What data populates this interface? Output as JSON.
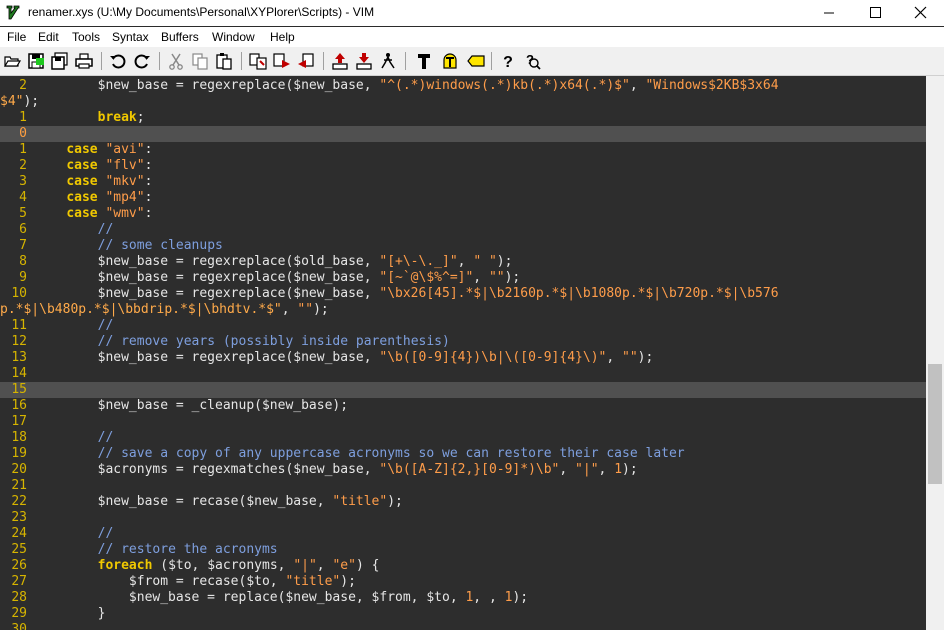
{
  "window": {
    "title": "renamer.xys (U:\\My Documents\\Personal\\XYPlorer\\Scripts) - VIM",
    "minimize_icon": "minimize-icon",
    "maximize_icon": "maximize-icon",
    "close_icon": "close-icon"
  },
  "menu": {
    "items": [
      "File",
      "Edit",
      "Tools",
      "Syntax",
      "Buffers",
      "Window",
      "Help"
    ]
  },
  "toolbar": {
    "icons": [
      "open-icon",
      "save-icon",
      "save-all-icon",
      "print-icon",
      "undo-icon",
      "redo-icon",
      "cut-icon",
      "copy-icon",
      "paste-icon",
      "find-replace-icon",
      "find-next-icon",
      "find-previous-icon",
      "load-session-icon",
      "save-session-icon",
      "run-script-icon",
      "make-icon",
      "run-ctags-icon",
      "jump-to-tag-icon",
      "help-icon",
      "find-help-icon"
    ]
  },
  "editor": {
    "lines": [
      {
        "num": "2",
        "segs": [
          [
            "code",
            "        $new_base = regexreplace($new_base, "
          ],
          [
            "str",
            "\"^(.*)windows(.*)kb(.*)x64(.*)$\""
          ],
          [
            "code",
            ", "
          ],
          [
            "str",
            "\"Windows$2KB$3x64"
          ]
        ]
      },
      {
        "num": "",
        "cont": "$4\"",
        "segs": [
          [
            "code",
            ");"
          ]
        ]
      },
      {
        "num": "1",
        "segs": [
          [
            "code",
            "        "
          ],
          [
            "kw",
            "break"
          ],
          [
            "code",
            ";"
          ]
        ]
      },
      {
        "num": "0",
        "cur": true,
        "segs": [
          [
            "code",
            ""
          ]
        ]
      },
      {
        "num": "1",
        "segs": [
          [
            "code",
            "    "
          ],
          [
            "kw",
            "case"
          ],
          [
            "code",
            " "
          ],
          [
            "str",
            "\"avi\""
          ],
          [
            "code",
            ":"
          ]
        ]
      },
      {
        "num": "2",
        "segs": [
          [
            "code",
            "    "
          ],
          [
            "kw",
            "case"
          ],
          [
            "code",
            " "
          ],
          [
            "str",
            "\"flv\""
          ],
          [
            "code",
            ":"
          ]
        ]
      },
      {
        "num": "3",
        "segs": [
          [
            "code",
            "    "
          ],
          [
            "kw",
            "case"
          ],
          [
            "code",
            " "
          ],
          [
            "str",
            "\"mkv\""
          ],
          [
            "code",
            ":"
          ]
        ]
      },
      {
        "num": "4",
        "segs": [
          [
            "code",
            "    "
          ],
          [
            "kw",
            "case"
          ],
          [
            "code",
            " "
          ],
          [
            "str",
            "\"mp4\""
          ],
          [
            "code",
            ":"
          ]
        ]
      },
      {
        "num": "5",
        "segs": [
          [
            "code",
            "    "
          ],
          [
            "kw",
            "case"
          ],
          [
            "code",
            " "
          ],
          [
            "str",
            "\"wmv\""
          ],
          [
            "code",
            ":"
          ]
        ]
      },
      {
        "num": "6",
        "segs": [
          [
            "code",
            "        "
          ],
          [
            "cmt",
            "//"
          ]
        ]
      },
      {
        "num": "7",
        "segs": [
          [
            "code",
            "        "
          ],
          [
            "cmt",
            "// some cleanups"
          ]
        ]
      },
      {
        "num": "8",
        "segs": [
          [
            "code",
            "        $new_base = regexreplace($old_base, "
          ],
          [
            "str",
            "\"[+\\-\\._]\""
          ],
          [
            "code",
            ", "
          ],
          [
            "str",
            "\" \""
          ],
          [
            "code",
            ");"
          ]
        ]
      },
      {
        "num": "9",
        "segs": [
          [
            "code",
            "        $new_base = regexreplace($new_base, "
          ],
          [
            "str",
            "\"[~`@\\$%^=]\""
          ],
          [
            "code",
            ", "
          ],
          [
            "str",
            "\"\""
          ],
          [
            "code",
            ");"
          ]
        ]
      },
      {
        "num": "10",
        "segs": [
          [
            "code",
            "        $new_base = regexreplace($new_base, "
          ],
          [
            "str",
            "\"\\bx26[45].*$|\\b2160p.*$|\\b1080p.*$|\\b720p.*$|\\b576"
          ]
        ]
      },
      {
        "num": "",
        "cont": "p.*$|\\b480p.*$|\\bbdrip.*$|\\bhdtv.*$\"",
        "segs": [
          [
            "code",
            ", "
          ],
          [
            "str",
            "\"\""
          ],
          [
            "code",
            ");"
          ]
        ]
      },
      {
        "num": "11",
        "segs": [
          [
            "code",
            "        "
          ],
          [
            "cmt",
            "//"
          ]
        ]
      },
      {
        "num": "12",
        "segs": [
          [
            "code",
            "        "
          ],
          [
            "cmt",
            "// remove years (possibly inside parenthesis)"
          ]
        ]
      },
      {
        "num": "13",
        "segs": [
          [
            "code",
            "        $new_base = regexreplace($new_base, "
          ],
          [
            "str",
            "\"\\b([0-9]{4})\\b|\\([0-9]{4}\\)\""
          ],
          [
            "code",
            ", "
          ],
          [
            "str",
            "\"\""
          ],
          [
            "code",
            ");"
          ]
        ]
      },
      {
        "num": "14",
        "segs": [
          [
            "code",
            ""
          ]
        ]
      },
      {
        "num": "15",
        "cur2": true,
        "segs": [
          [
            "code",
            ""
          ]
        ]
      },
      {
        "num": "16",
        "segs": [
          [
            "code",
            "        $new_base = _cleanup($new_base);"
          ]
        ]
      },
      {
        "num": "17",
        "segs": [
          [
            "code",
            ""
          ]
        ]
      },
      {
        "num": "18",
        "segs": [
          [
            "code",
            "        "
          ],
          [
            "cmt",
            "//"
          ]
        ]
      },
      {
        "num": "19",
        "segs": [
          [
            "code",
            "        "
          ],
          [
            "cmt",
            "// save a copy of any uppercase acronyms so we can restore their case later"
          ]
        ]
      },
      {
        "num": "20",
        "segs": [
          [
            "code",
            "        $acronyms = regexmatches($new_base, "
          ],
          [
            "str",
            "\"\\b([A-Z]{2,}[0-9]*)\\b\""
          ],
          [
            "code",
            ", "
          ],
          [
            "str",
            "\"|\""
          ],
          [
            "code",
            ", "
          ],
          [
            "str",
            "1"
          ],
          [
            "code",
            ");"
          ]
        ]
      },
      {
        "num": "21",
        "segs": [
          [
            "code",
            ""
          ]
        ]
      },
      {
        "num": "22",
        "segs": [
          [
            "code",
            "        $new_base = recase($new_base, "
          ],
          [
            "str",
            "\"title\""
          ],
          [
            "code",
            ");"
          ]
        ]
      },
      {
        "num": "23",
        "segs": [
          [
            "code",
            ""
          ]
        ]
      },
      {
        "num": "24",
        "segs": [
          [
            "code",
            "        "
          ],
          [
            "cmt",
            "//"
          ]
        ]
      },
      {
        "num": "25",
        "segs": [
          [
            "code",
            "        "
          ],
          [
            "cmt",
            "// restore the acronyms"
          ]
        ]
      },
      {
        "num": "26",
        "segs": [
          [
            "code",
            "        "
          ],
          [
            "kw",
            "foreach"
          ],
          [
            "code",
            " ($to, $acronyms, "
          ],
          [
            "str",
            "\"|\""
          ],
          [
            "code",
            ", "
          ],
          [
            "str",
            "\"e\""
          ],
          [
            "code",
            ") {"
          ]
        ]
      },
      {
        "num": "27",
        "segs": [
          [
            "code",
            "            $from = recase($to, "
          ],
          [
            "str",
            "\"title\""
          ],
          [
            "code",
            ");"
          ]
        ]
      },
      {
        "num": "28",
        "segs": [
          [
            "code",
            "            $new_base = replace($new_base, $from, $to, "
          ],
          [
            "str",
            "1"
          ],
          [
            "code",
            ", , "
          ],
          [
            "str",
            "1"
          ],
          [
            "code",
            ");"
          ]
        ]
      },
      {
        "num": "29",
        "segs": [
          [
            "code",
            "        }"
          ]
        ]
      },
      {
        "num": "30",
        "segs": [
          [
            "code",
            ""
          ]
        ]
      }
    ]
  },
  "colors": {
    "background": "#2d2d2d",
    "line_number": "#d6b400",
    "string": "#ff9d4a",
    "keyword": "#f0c800",
    "comment": "#7e9fde",
    "cursor": "#1ec81e"
  }
}
